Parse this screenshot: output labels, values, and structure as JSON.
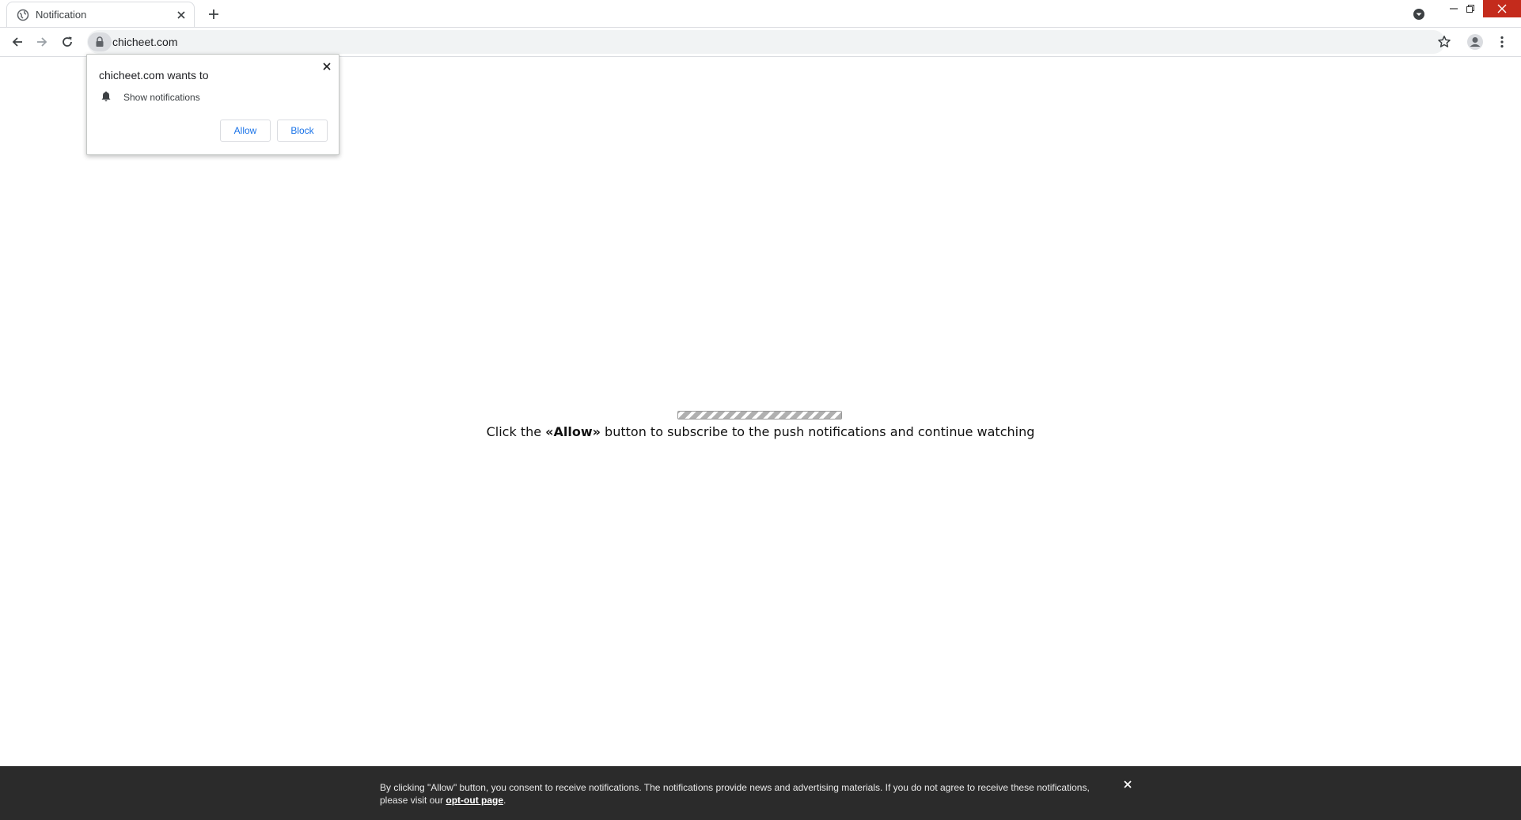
{
  "browser": {
    "tab": {
      "title": "Notification"
    },
    "address_bar": {
      "url": "chicheet.com"
    }
  },
  "permission_popup": {
    "title": "chicheet.com wants to",
    "permission": "Show notifications",
    "allow_label": "Allow",
    "block_label": "Block"
  },
  "page": {
    "instruction_prefix": "Click the ",
    "instruction_bold": "«Allow»",
    "instruction_suffix": " button to subscribe to the push notifications and continue watching"
  },
  "consent_bar": {
    "text": "By clicking \"Allow\" button, you consent to receive notifications. The notifications provide news and advertising materials. If you do not agree to receive these notifications, please visit our ",
    "link": "opt-out page",
    "text_end": "."
  },
  "icons": {
    "tab_favicon": "globe-icon",
    "tab_close": "close-icon",
    "new_tab": "plus-icon",
    "tab_search": "chevron-down-circle-icon",
    "back": "arrow-left-icon",
    "forward": "arrow-right-icon",
    "reload": "reload-icon",
    "lock": "lock-icon",
    "bookmark": "star-icon",
    "profile": "avatar-icon",
    "menu": "kebab-icon",
    "bell": "bell-icon"
  },
  "colors": {
    "accent_blue": "#1a73e8",
    "window_close": "#c42b1c",
    "consent_bg": "#2b2b2b",
    "omnibox_bg": "#f1f3f4"
  }
}
